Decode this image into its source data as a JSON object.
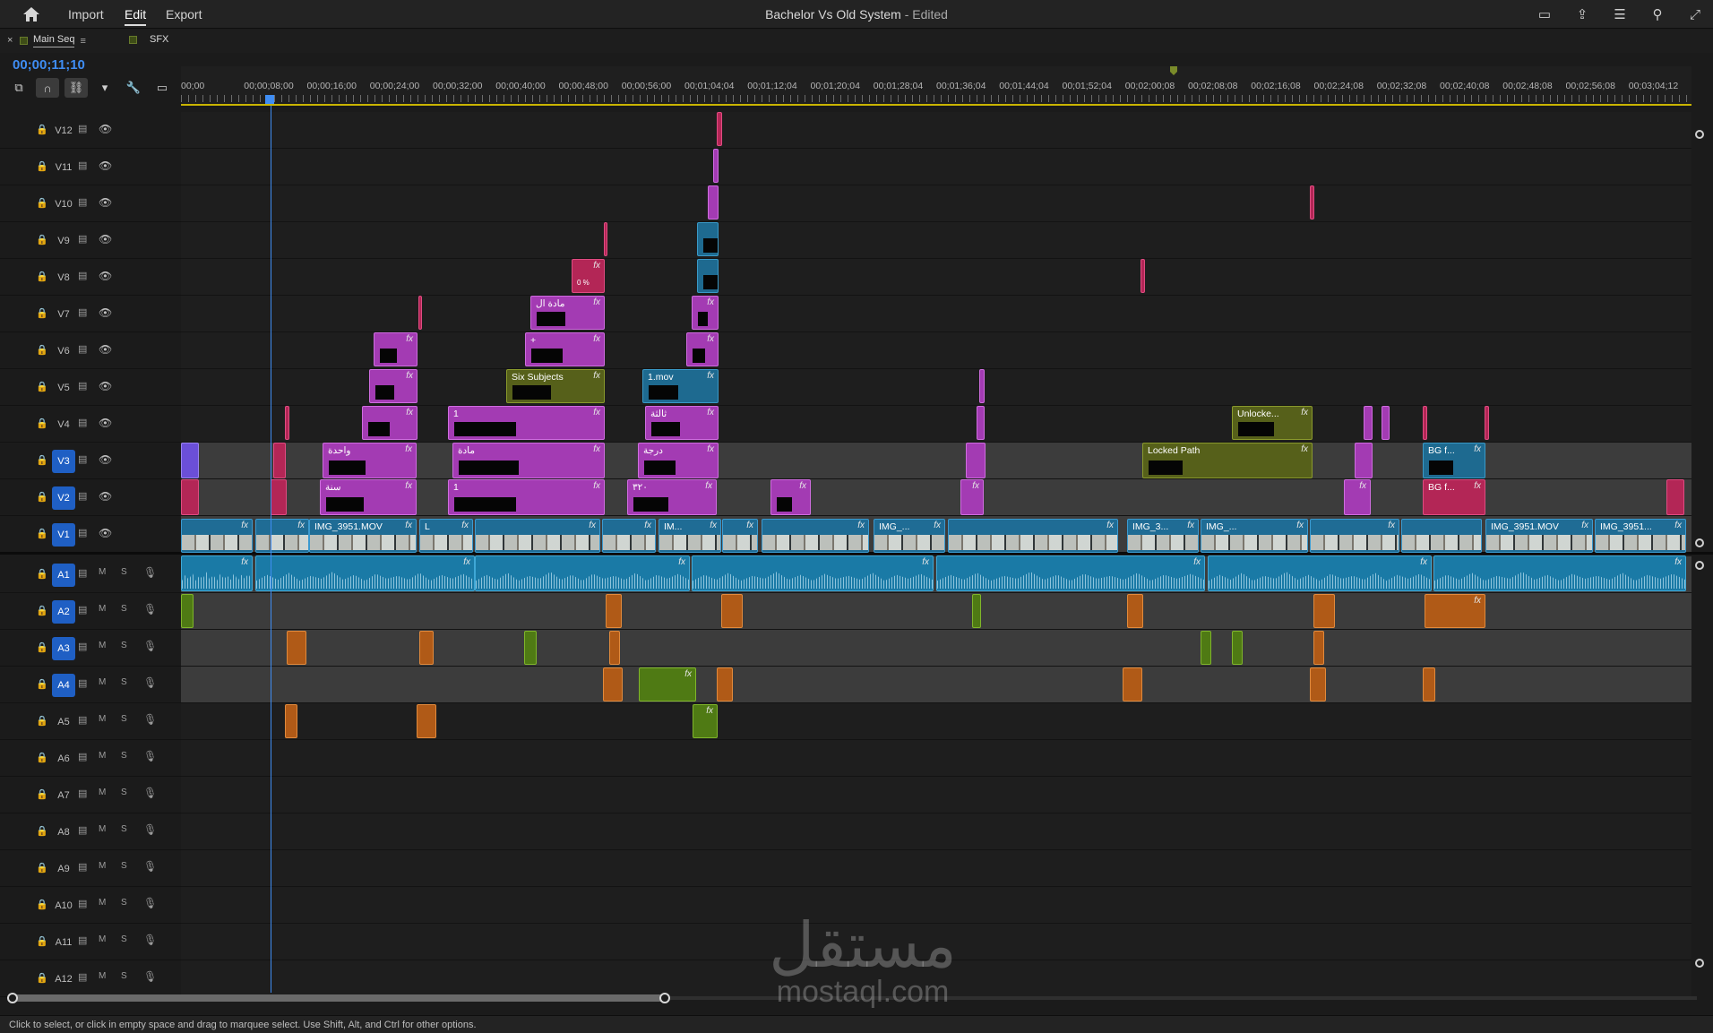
{
  "app": {
    "menus": [
      "Import",
      "Edit",
      "Export"
    ],
    "active_menu": "Edit",
    "title": "Bachelor Vs Old System",
    "title_status": "- Edited"
  },
  "sequence_tabs": [
    {
      "label": "Main Seq",
      "active": true
    },
    {
      "label": "SFX",
      "active": false
    }
  ],
  "timecode": "00;00;11;10",
  "ruler_labels": [
    "00;00",
    "00;00;08;00",
    "00;00;16;00",
    "00;00;24;00",
    "00;00;32;00",
    "00;00;40;00",
    "00;00;48;00",
    "00;00;56;00",
    "00;01;04;04",
    "00;01;12;04",
    "00;01;20;04",
    "00;01;28;04",
    "00;01;36;04",
    "00;01;44;04",
    "00;01;52;04",
    "00;02;00;08",
    "00;02;08;08",
    "00;02;16;08",
    "00;02;24;08",
    "00;02;32;08",
    "00;02;40;08",
    "00;02;48;08",
    "00;02;56;08",
    "00;03;04;12"
  ],
  "video_tracks": [
    "V12",
    "V11",
    "V10",
    "V9",
    "V8",
    "V7",
    "V6",
    "V5",
    "V4",
    "V3",
    "V2",
    "V1"
  ],
  "audio_tracks": [
    "A1",
    "A2",
    "A3",
    "A4",
    "A5",
    "A6",
    "A7",
    "A8",
    "A9",
    "A10",
    "A11",
    "A12"
  ],
  "audio_buttons": {
    "mute": "M",
    "solo": "S"
  },
  "clips": {
    "six_subjects": "Six Subjects",
    "one_mov": "1.mov",
    "unlocked": "Unlocke...",
    "locked_path": "Locked Path",
    "bg_f1": "BG f...",
    "bg_f2": "BG f...",
    "img_3951_mov": "IMG_3951.MOV",
    "img_3951_mov_2": "IMG_3951.MOV",
    "img_3951_3": "IMG_3951...",
    "img_a": "IMG_...",
    "img_b": "IMG_3...",
    "img_c": "IMG_...",
    "img_d": "IM...",
    "l": "L",
    "ar_wahda": "واحدة",
    "ar_sana": "سنة",
    "ar_mada": "مادة",
    "ar_mada2": "مادة ال",
    "ar_daraja": "درجة",
    "ar_thalatha": "ثالثة",
    "ar_320": "٣٢٠",
    "one": "1",
    "plus": "+",
    "pct": "0 %",
    "fx": "fx"
  },
  "status_text": "Click to select, or click in empty space and drag to marquee select. Use Shift, Alt, and Ctrl for other options.",
  "watermark": {
    "arabic": "مستقل",
    "latin": "mostaql.com"
  }
}
